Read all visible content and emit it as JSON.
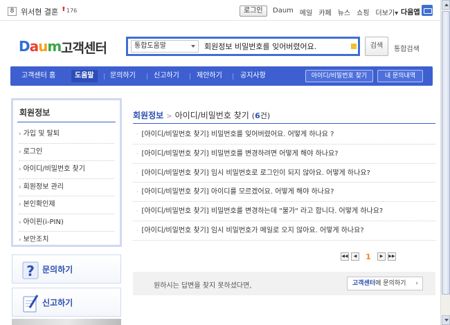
{
  "topbar": {
    "rank": "8",
    "rank_name": "위서현 결혼",
    "rank_trend": "⬆",
    "rank_count": "176",
    "login_label": "로그인",
    "links": [
      "Daum",
      "메일",
      "카페",
      "뉴스",
      "쇼핑",
      "더보기▾"
    ],
    "start_label": "다음앱"
  },
  "logo": {
    "brand_d": "D",
    "brand_a": "a",
    "brand_u": "u",
    "brand_m": "m",
    "sub": "고객센터"
  },
  "search": {
    "scope": "통합도움말",
    "query": "회원정보 비밀번호를 잊어버렸어요.",
    "button": "검색",
    "unified": "통합검색"
  },
  "nav": {
    "items": [
      "고객센터 홈",
      "도움말",
      "문의하기",
      "신고하기",
      "제안하기",
      "공지사항"
    ],
    "active_index": 1,
    "right_buttons": [
      "아이디/비밀번호 찾기",
      "내 문의내역"
    ]
  },
  "sidebar": {
    "title": "회원정보",
    "items": [
      "가입 및 탈퇴",
      "로그인",
      "아이디/비밀번호 찾기",
      "회원정보 관리",
      "본인확인제",
      "아이핀(i-PIN)",
      "보안조치"
    ],
    "cards": [
      "문의하기",
      "신고하기"
    ]
  },
  "main": {
    "crumb_parent": "회원정보",
    "crumb_current": "아이디/비밀번호 찾기",
    "count": "6",
    "count_unit": "건",
    "faqs": [
      "[아이디/비밀번호 찾기] 비밀번호를 잊어버렸어요. 어떻게 하나요 ?",
      "[아이디/비밀번호 찾기] 비밀번호를 변경하려면 어떻게 해야 하나요?",
      "[아이디/비밀번호 찾기] 임시 비밀번호로 로그인이 되지 않아요. 어떻게 하나요?",
      "[아이디/비밀번호 찾기] 아이디를 모르겠어요. 어떻게 해야 하나요?",
      "[아이디/비밀번호 찾기] 비밀번호를 변경하는데 \"불가\" 라고 합니다. 어떻게 하나요?",
      "[아이디/비밀번호 찾기] 임시 비밀번호가 메일로 오지 않아요. 어떻게 하나요?"
    ],
    "pager_current": "1",
    "footer_text": "원하시는 답변을 찾지 못하셨다면,",
    "footer_btn_bold": "고객센터",
    "footer_btn_rest": "에 문의하기"
  },
  "colors": {
    "nav_blue": "#3d5fd0",
    "link_blue": "#2c4fae",
    "accent_orange": "#f0831e"
  }
}
